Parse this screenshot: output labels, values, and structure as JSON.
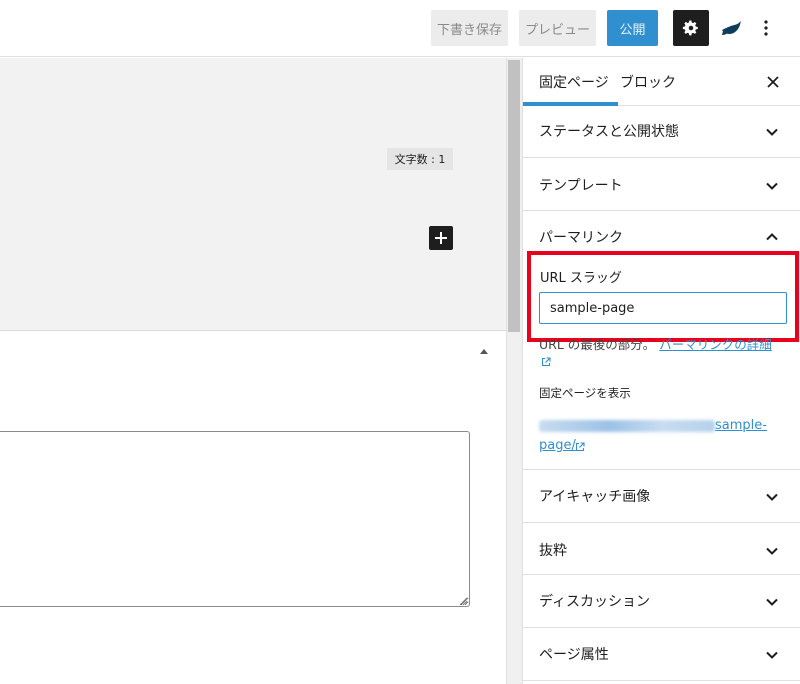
{
  "toolbar": {
    "save_draft_label": "下書き保存",
    "preview_label": "プレビュー",
    "publish_label": "公開"
  },
  "editor": {
    "word_count_label": "文字数 : 1",
    "textarea_value": ""
  },
  "sidebar": {
    "tabs": [
      {
        "label": "固定ページ",
        "active": true
      },
      {
        "label": "ブロック",
        "active": false
      }
    ],
    "panels": {
      "status": "ステータスと公開状態",
      "template": "テンプレート",
      "permalink": "パーマリンク",
      "featured_image": "アイキャッチ画像",
      "excerpt": "抜粋",
      "discussion": "ディスカッション",
      "page_attributes": "ページ属性"
    },
    "permalink": {
      "slug_label": "URL スラッグ",
      "slug_value": "sample-page",
      "help_text": "URL の最後の部分。",
      "help_link": "パーマリンクの詳細",
      "view_page_label": "固定ページを表示",
      "url_slug_part1": "sample-",
      "url_slug_part2": "page/"
    }
  },
  "colors": {
    "accent": "#2f8fcf",
    "highlight": "#e8001c",
    "dark": "#1e1e1e"
  }
}
